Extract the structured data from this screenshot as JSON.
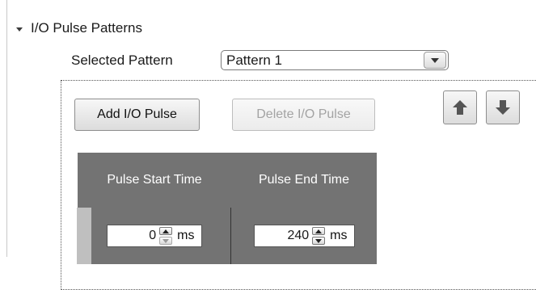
{
  "section": {
    "title": "I/O Pulse Patterns",
    "expanded": true
  },
  "pattern_selector": {
    "label": "Selected Pattern",
    "value": "Pattern 1"
  },
  "buttons": {
    "add_label": "Add I/O Pulse",
    "delete_label": "Delete I/O Pulse",
    "delete_enabled": false,
    "move_up_icon": "arrow-up-icon",
    "move_down_icon": "arrow-down-icon"
  },
  "table": {
    "headers": [
      "Pulse Start Time",
      "Pulse End Time"
    ],
    "rows": [
      {
        "start_value": "0",
        "start_unit": "ms",
        "end_value": "240",
        "end_unit": "ms"
      }
    ]
  },
  "colors": {
    "table_header_bg": "#737373",
    "table_header_text": "#ffffff"
  }
}
